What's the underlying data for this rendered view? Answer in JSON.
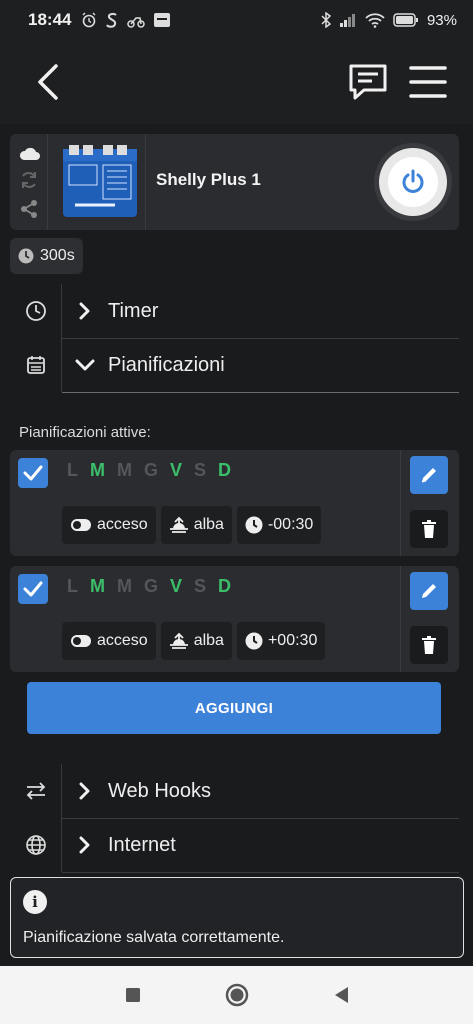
{
  "status_bar": {
    "time": "18:44",
    "battery_pct": "93%",
    "notif_icons": [
      "alarm-icon",
      "s-icon",
      "moped-icon",
      "rtt-icon"
    ]
  },
  "app_bar": {
    "icons": [
      "back-arrow-icon",
      "chat-icon",
      "hamburger-menu-icon"
    ]
  },
  "device": {
    "name": "Shelly Plus 1",
    "side_icons": [
      "cloud-icon",
      "sync-icon",
      "share-icon"
    ],
    "power_icon": "power-icon",
    "accent": "#3c82d8"
  },
  "chip_300": {
    "label": "300s",
    "icon": "clock-icon"
  },
  "sections": {
    "timer": {
      "label": "Timer",
      "icon": "clock-icon"
    },
    "schedules": {
      "label": "Pianificazioni",
      "icon": "calendar-icon"
    },
    "webhooks": {
      "label": "Web Hooks",
      "icon": "swap-arrows-icon"
    },
    "internet": {
      "label": "Internet",
      "icon": "globe-icon"
    }
  },
  "schedules_title": "Pianificazioni attive:",
  "schedules": [
    {
      "checked": true,
      "days": [
        {
          "letter": "L",
          "active": false
        },
        {
          "letter": "M",
          "active": true
        },
        {
          "letter": "M",
          "active": false
        },
        {
          "letter": "G",
          "active": false
        },
        {
          "letter": "V",
          "active": true
        },
        {
          "letter": "S",
          "active": false
        },
        {
          "letter": "D",
          "active": true
        }
      ],
      "state": "acceso",
      "event": "alba",
      "offset": "-00:30"
    },
    {
      "checked": true,
      "days": [
        {
          "letter": "L",
          "active": false
        },
        {
          "letter": "M",
          "active": true
        },
        {
          "letter": "M",
          "active": false
        },
        {
          "letter": "G",
          "active": false
        },
        {
          "letter": "V",
          "active": true
        },
        {
          "letter": "S",
          "active": false
        },
        {
          "letter": "D",
          "active": true
        }
      ],
      "state": "acceso",
      "event": "alba",
      "offset": "+00:30"
    }
  ],
  "add_button": "AGGIUNGI",
  "toast": {
    "icon": "info-icon",
    "message": "Pianificazione salvata correttamente."
  },
  "nav_bar": {
    "icons": [
      "recents-square-icon",
      "home-circle-icon",
      "back-triangle-icon"
    ]
  },
  "colors": {
    "active_day": "#3bbf6a",
    "inactive_day": "#555659",
    "accent": "#3c82d8"
  }
}
